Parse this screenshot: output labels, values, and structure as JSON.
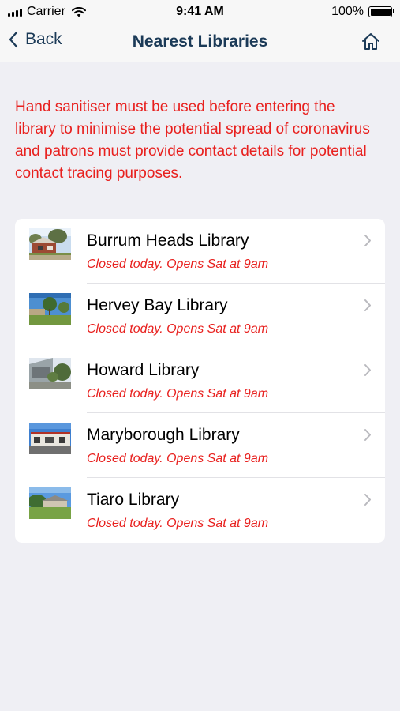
{
  "status_bar": {
    "carrier": "Carrier",
    "time": "9:41 AM",
    "battery": "100%"
  },
  "nav": {
    "back_label": "Back",
    "title": "Nearest Libraries",
    "home_icon": "home-icon"
  },
  "notice": "Hand sanitiser must be used before entering the library to minimise the potential spread of coronavirus and patrons must provide contact details for potential contact tracing purposes.",
  "colors": {
    "accent": "#1b3a57",
    "alert": "#e8201e",
    "background": "#efeff4"
  },
  "libraries": [
    {
      "name": "Burrum Heads Library",
      "status": "Closed today. Opens Sat at 9am"
    },
    {
      "name": "Hervey Bay Library",
      "status": "Closed today. Opens Sat at 9am"
    },
    {
      "name": "Howard Library",
      "status": "Closed today. Opens Sat at 9am"
    },
    {
      "name": "Maryborough Library",
      "status": "Closed today. Opens Sat at 9am"
    },
    {
      "name": "Tiaro Library",
      "status": "Closed today. Opens Sat at 9am"
    }
  ]
}
